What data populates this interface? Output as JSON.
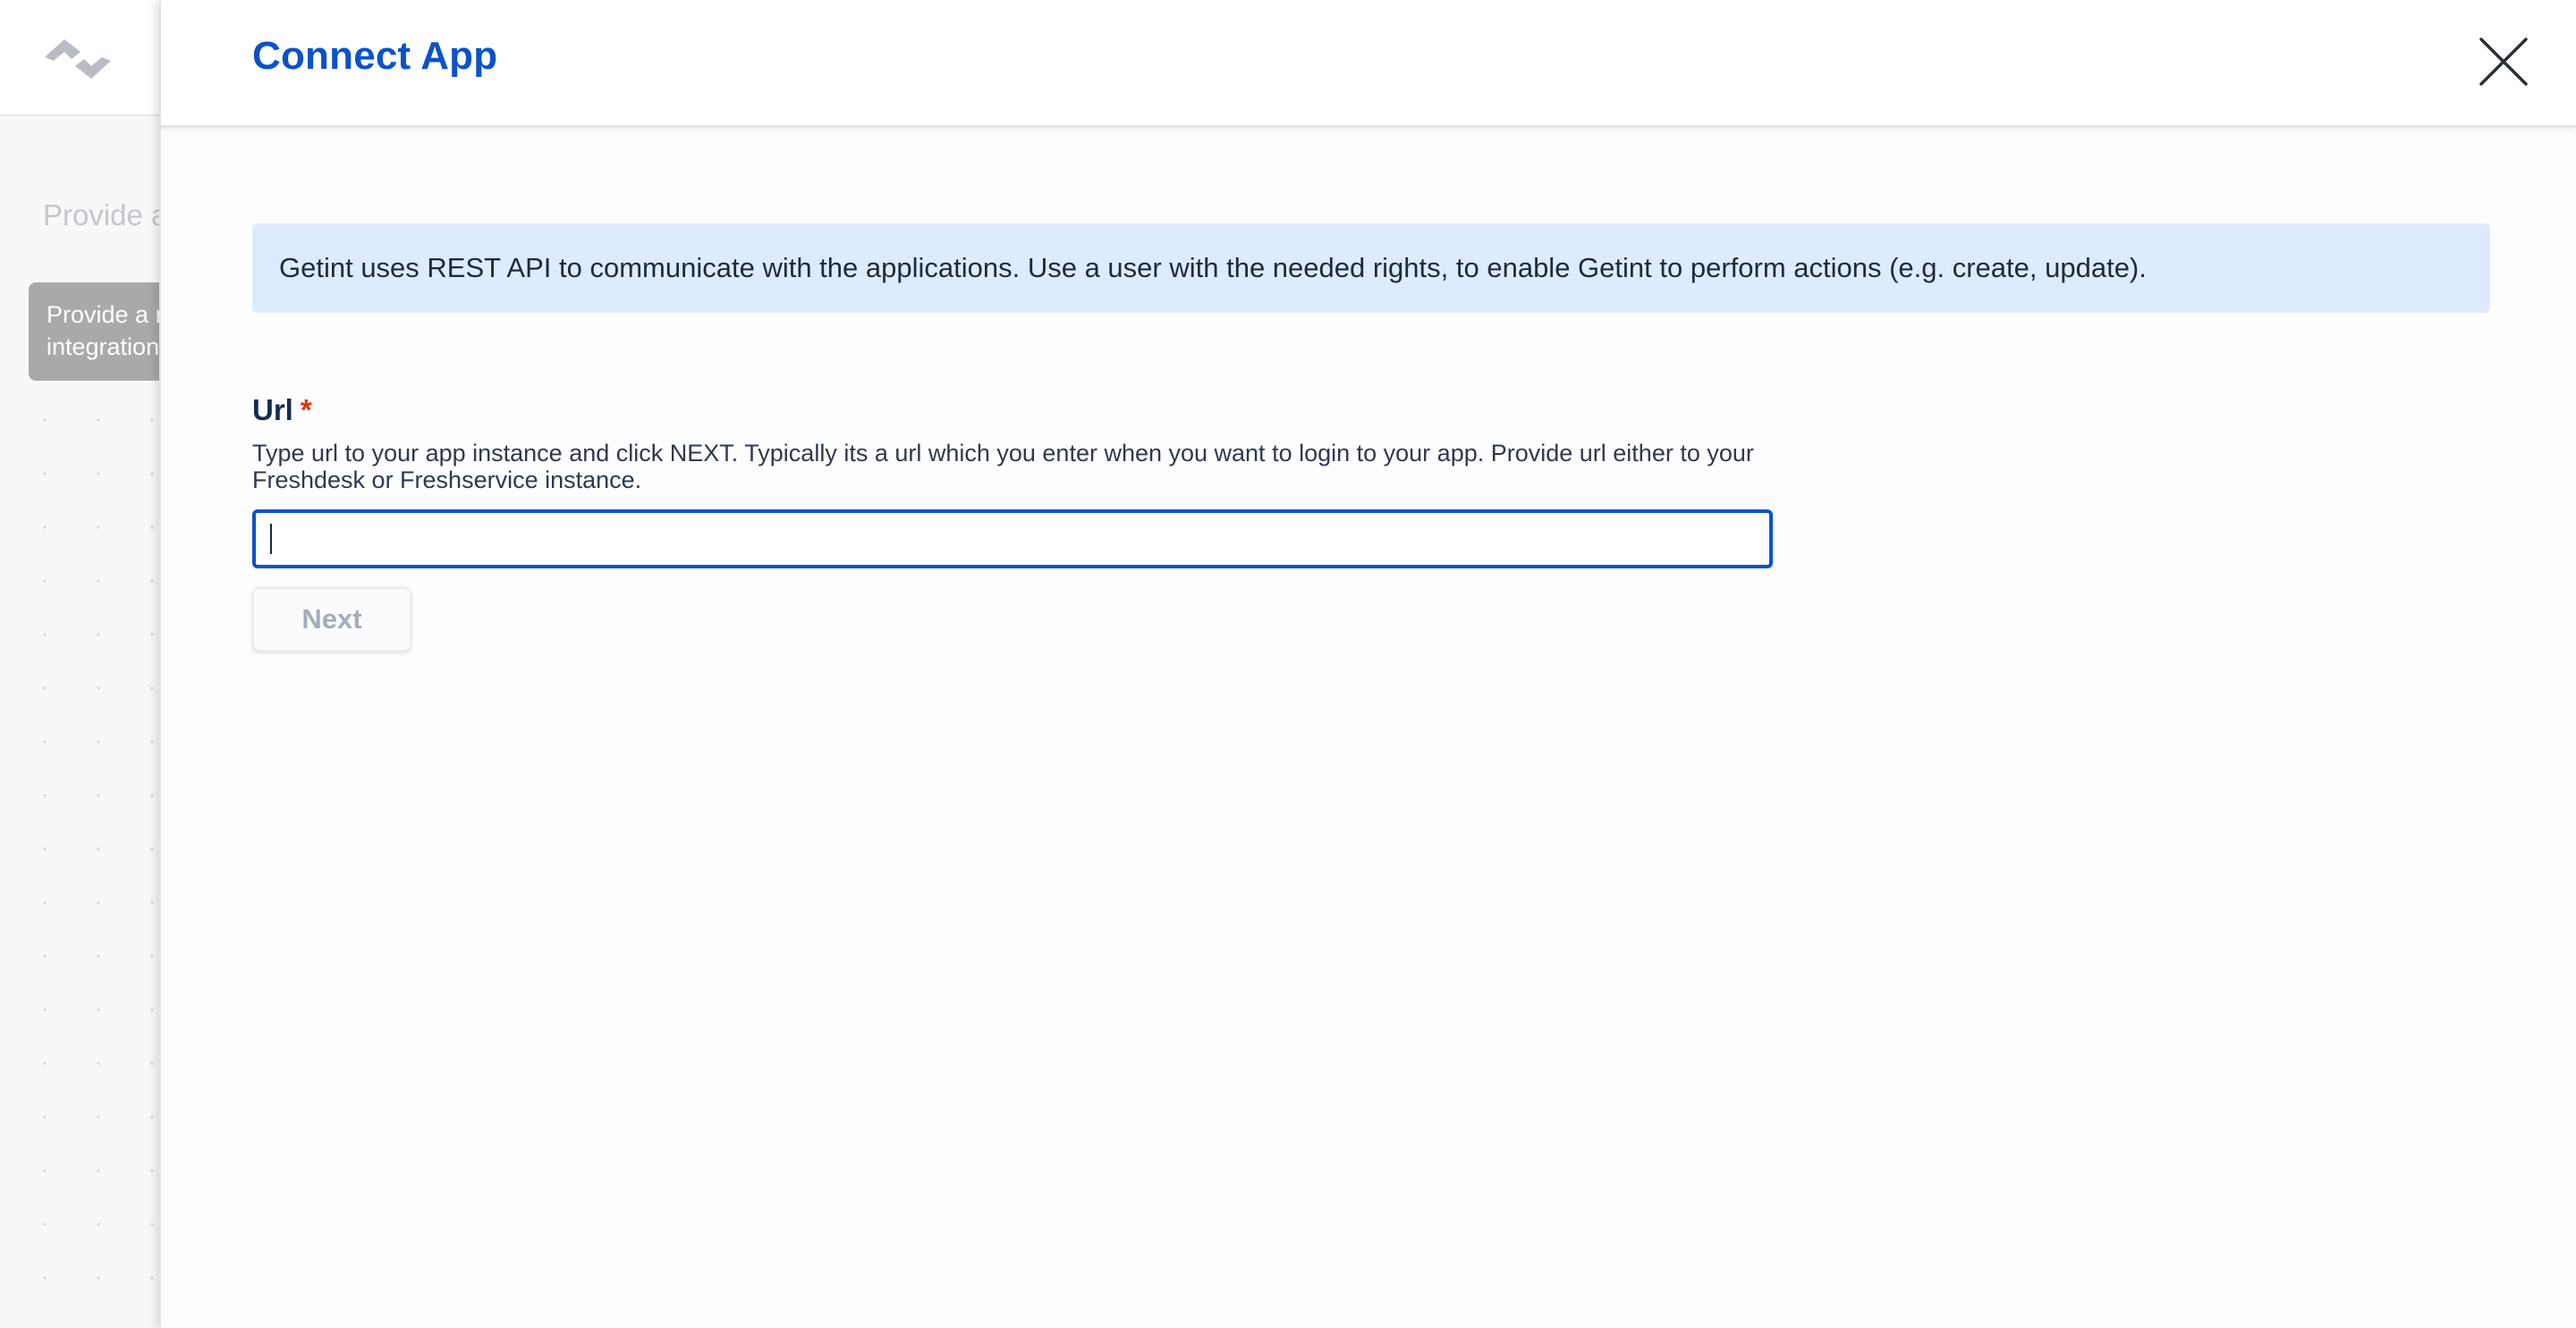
{
  "background": {
    "heading": "Provide a",
    "tooltip_line1": "Provide a n",
    "tooltip_line2": "integration"
  },
  "drawer": {
    "title": "Connect App",
    "close_icon": "close-icon",
    "info_text": "Getint uses REST API to communicate with the applications. Use a user with the needed rights, to enable Getint to perform actions (e.g. create, update).",
    "url_field": {
      "label": "Url",
      "required_marker": "*",
      "help": "Type url to your app instance and click NEXT. Typically its a url which you enter when you want to login to your app. Provide url either to your Freshdesk or Freshservice instance.",
      "value": "",
      "placeholder": ""
    },
    "next_label": "Next"
  },
  "colors": {
    "accent": "#0b52c9",
    "info_bg": "#deebff",
    "required": "#de350b",
    "disabled_text": "#a5adba"
  }
}
